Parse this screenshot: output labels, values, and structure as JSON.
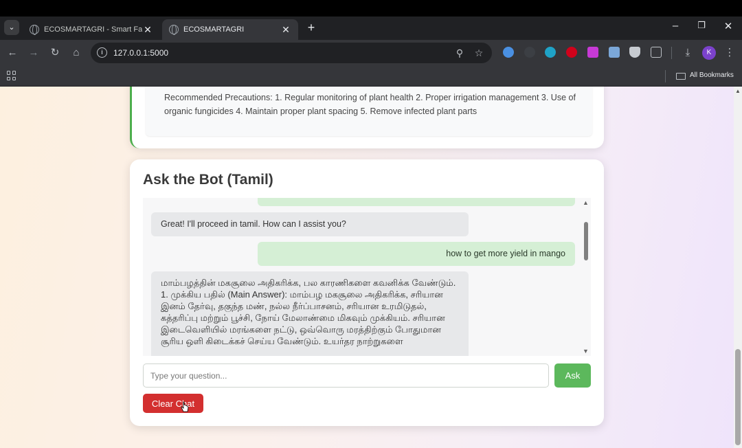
{
  "browser": {
    "tabs": [
      {
        "title": "ECOSMARTAGRI - Smart Farm",
        "active": false
      },
      {
        "title": "ECOSMARTAGRI",
        "active": true
      }
    ],
    "url": "127.0.0.1:5000",
    "bookmarks_label": "All Bookmarks",
    "profile_initial": "K"
  },
  "precautions": {
    "text": "Recommended Precautions: 1. Regular monitoring of plant health 2. Proper irrigation management 3. Use of organic fungicides 4. Maintain proper plant spacing 5. Remove infected plant parts"
  },
  "chatbot": {
    "title": "Ask the Bot (Tamil)",
    "messages": [
      {
        "role": "bot",
        "text": "Great! I'll proceed in tamil. How can I assist you?"
      },
      {
        "role": "user",
        "text": "how to get more yield in mango"
      },
      {
        "role": "bot",
        "text": "மாம்பழத்தின் மகசூலை அதிகரிக்க, பல காரணிகளை கவனிக்க வேண்டும். 1. முக்கிய பதில் (Main Answer): மாம்பழ மகசூலை அதிகரிக்க, சரியான இனம் தேர்வு, தகுந்த மண், நல்ல நீர்ப்பாசனம், சரியான உரமிடுதல், கத்தரிப்பு மற்றும் பூச்சி, நோய் மேலாண்மை மிகவும் முக்கியம். சரியான இடைவெளியில் மரங்களை நட்டு, ஒவ்வொரு மரத்திற்கும் போதுமான சூரிய ஒளி கிடைக்கச் செய்ய வேண்டும். உயர்தர நாற்றுகளை"
      }
    ],
    "input_placeholder": "Type your question...",
    "ask_label": "Ask",
    "clear_label": "Clear Chat"
  },
  "colors": {
    "ask_button": "#5cb85c",
    "clear_button": "#d32f2f",
    "user_bubble": "#d5efd5",
    "bot_bubble": "#e7e8ea",
    "accent_border": "#4cae4c"
  }
}
